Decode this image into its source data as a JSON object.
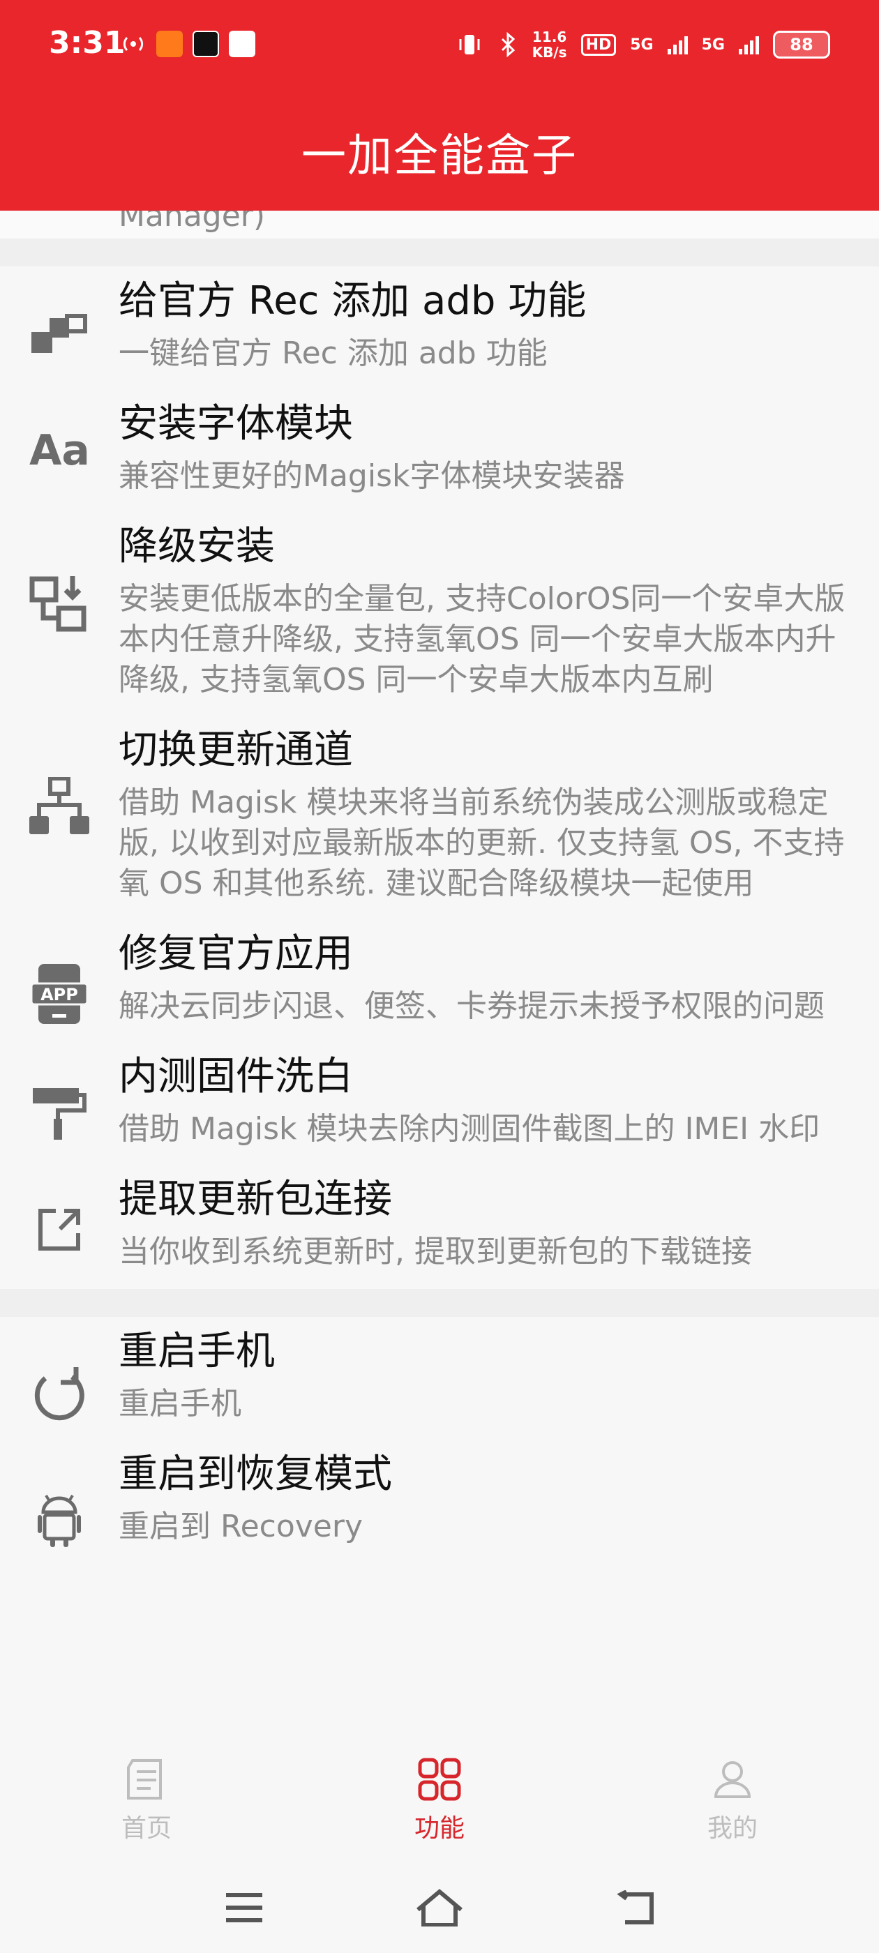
{
  "status_bar": {
    "time": "3:31",
    "speed_value": "11.6",
    "speed_unit": "KB/s",
    "hd_label": "HD",
    "net1": "5G",
    "net2": "5G",
    "battery": "88"
  },
  "app_bar": {
    "title": "一加全能盒子"
  },
  "previous_tail": "Manager)",
  "group1": [
    {
      "title": "给官方 Rec 添加 adb 功能",
      "desc": "一键给官方 Rec 添加 adb 功能",
      "icon": "puzzle-blocks-icon"
    },
    {
      "title": "安装字体模块",
      "desc": "兼容性更好的Magisk字体模块安装器",
      "icon": "font-aa-icon"
    },
    {
      "title": "降级安装",
      "desc": "安装更低版本的全量包, 支持ColorOS同一个安卓大版本内任意升降级, 支持氢氧OS 同一个安卓大版本内升降级, 支持氢氧OS 同一个安卓大版本内互刷",
      "icon": "downgrade-icon"
    },
    {
      "title": "切换更新通道",
      "desc": "借助 Magisk 模块来将当前系统伪装成公测版或稳定版, 以收到对应最新版本的更新. 仅支持氢 OS, 不支持氧 OS 和其他系统. 建议配合降级模块一起使用",
      "icon": "hierarchy-icon"
    },
    {
      "title": "修复官方应用",
      "desc": "解决云同步闪退、便签、卡券提示未授予权限的问题",
      "icon": "app-phone-icon"
    },
    {
      "title": "内测固件洗白",
      "desc": "借助 Magisk 模块去除内测固件截图上的 IMEI 水印",
      "icon": "paint-roller-icon"
    },
    {
      "title": "提取更新包连接",
      "desc": "当你收到系统更新时, 提取到更新包的下载链接",
      "icon": "external-link-icon"
    }
  ],
  "group2": [
    {
      "title": "重启手机",
      "desc": "重启手机",
      "icon": "restart-icon"
    },
    {
      "title": "重启到恢复模式",
      "desc": "重启到 Recovery",
      "icon": "android-icon"
    }
  ],
  "bottom_nav": {
    "tabs": [
      {
        "label": "首页",
        "icon": "document-icon",
        "active": false
      },
      {
        "label": "功能",
        "icon": "grid-icon",
        "active": true
      },
      {
        "label": "我的",
        "icon": "person-icon",
        "active": false
      }
    ]
  },
  "colors": {
    "accent": "#e8262b",
    "active_tab": "#d7262b",
    "icon_gray": "#6b6b6b",
    "secondary_text": "#8a8a8a"
  }
}
